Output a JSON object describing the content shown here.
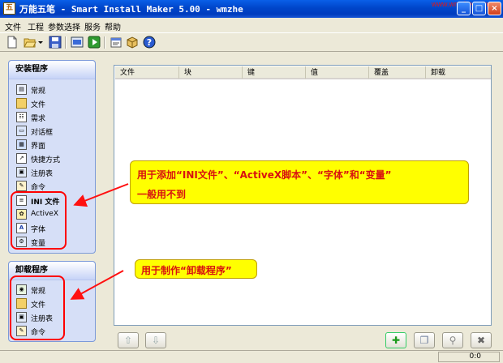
{
  "window": {
    "title": "万能五笔 - Smart Install Maker 5.00 - wmzhe",
    "app_icon_glyph": "五",
    "watermark": "www.wmzhe.com",
    "controls": [
      "_",
      "□",
      "×"
    ]
  },
  "menu": [
    "文件",
    "工程",
    "参数选择",
    "服务",
    "帮助"
  ],
  "install_panel": {
    "title": "安装程序",
    "items": [
      {
        "label": "常规",
        "icon": "general-icon"
      },
      {
        "label": "文件",
        "icon": "folder-icon"
      },
      {
        "label": "需求",
        "icon": "requirements-icon"
      },
      {
        "label": "对话框",
        "icon": "dialog-icon"
      },
      {
        "label": "界面",
        "icon": "interface-icon"
      },
      {
        "label": "快捷方式",
        "icon": "shortcut-icon"
      },
      {
        "label": "注册表",
        "icon": "registry-icon"
      },
      {
        "label": "命令",
        "icon": "command-icon"
      },
      {
        "label": "INI 文件",
        "icon": "ini-file-icon"
      },
      {
        "label": "ActiveX",
        "icon": "activex-icon"
      },
      {
        "label": "字体",
        "icon": "font-icon"
      },
      {
        "label": "变量",
        "icon": "variable-icon"
      }
    ]
  },
  "uninstall_panel": {
    "title": "卸载程序",
    "items": [
      {
        "label": "常规",
        "icon": "general-icon"
      },
      {
        "label": "文件",
        "icon": "folder-icon"
      },
      {
        "label": "注册表",
        "icon": "registry-icon"
      },
      {
        "label": "命令",
        "icon": "command-icon"
      }
    ]
  },
  "table": {
    "columns": [
      "文件",
      "块",
      "键",
      "值",
      "覆盖",
      "卸载"
    ]
  },
  "callouts": {
    "top_line1": "用于添加“INI文件”、“ActiveX脚本”、“字体”和“变量”",
    "top_line2": "一般用不到",
    "bottom": "用于制作“卸载程序”"
  },
  "status": {
    "position": "0:0"
  },
  "colors": {
    "callout_bg": "#ffff00",
    "callout_text": "#d81010",
    "highlight_ring": "#ff0000",
    "title_bar": "#0a5fe8"
  }
}
